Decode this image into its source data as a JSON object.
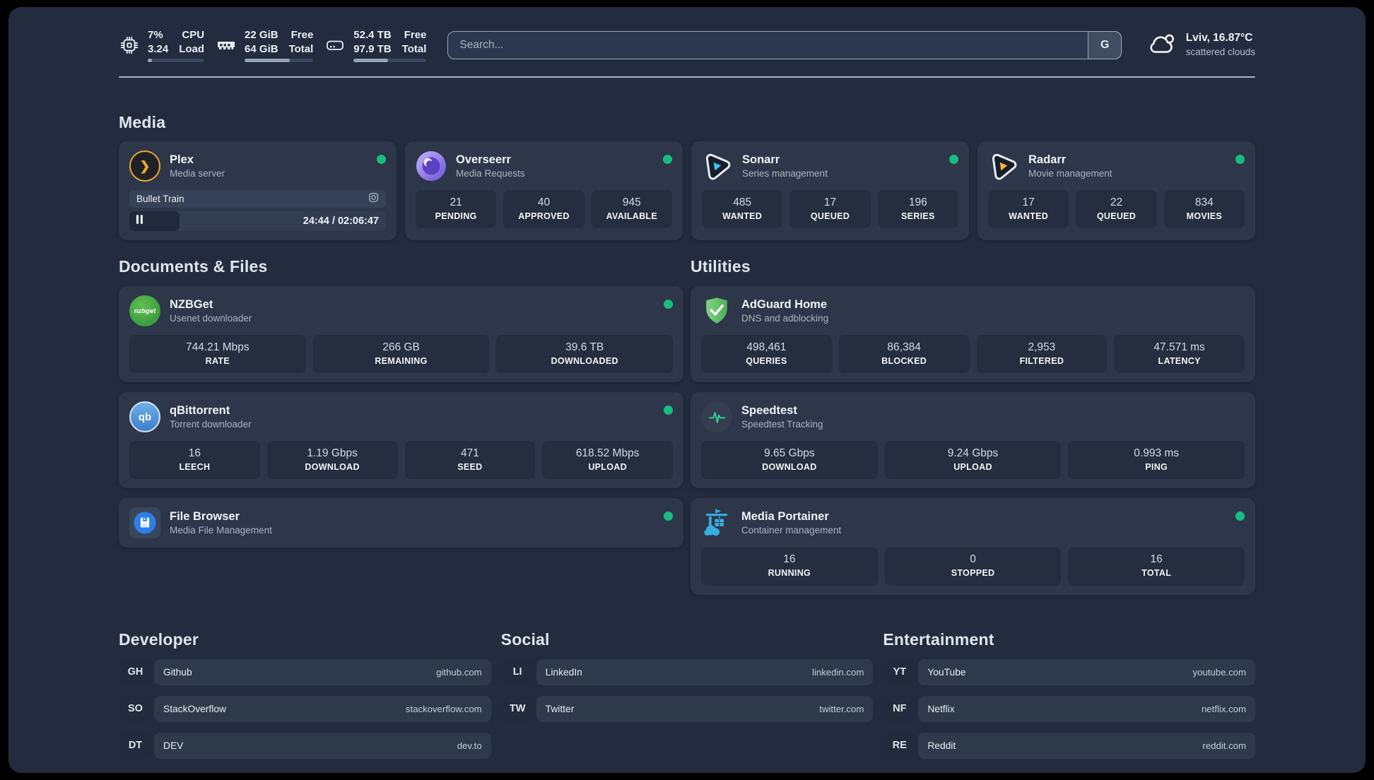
{
  "header": {
    "cpu": {
      "value_top": "7%",
      "value_bottom": "3.24",
      "label_top": "CPU",
      "label_bottom": "Load",
      "progress_pct": 7
    },
    "ram": {
      "value_top": "22 GiB",
      "value_bottom": "64 GiB",
      "label_top": "Free",
      "label_bottom": "Total",
      "progress_pct": 66
    },
    "disk": {
      "value_top": "52.4 TB",
      "value_bottom": "97.9 TB",
      "label_top": "Free",
      "label_bottom": "Total",
      "progress_pct": 47
    },
    "search": {
      "placeholder": "Search...",
      "provider_button": "G"
    },
    "weather": {
      "main": "Lviv, 16.87°C",
      "condition": "scattered clouds"
    }
  },
  "sections": {
    "media": "Media",
    "documents": "Documents & Files",
    "utilities": "Utilities",
    "developer": "Developer",
    "social": "Social",
    "entertainment": "Entertainment"
  },
  "apps": {
    "plex": {
      "name": "Plex",
      "desc": "Media server",
      "now_playing": {
        "title": "Bullet Train",
        "time": "24:44 / 02:06:47",
        "progress_pct": 19.5
      }
    },
    "overseerr": {
      "name": "Overseerr",
      "desc": "Media Requests",
      "stats": [
        {
          "value": "21",
          "label": "PENDING"
        },
        {
          "value": "40",
          "label": "APPROVED"
        },
        {
          "value": "945",
          "label": "AVAILABLE"
        }
      ]
    },
    "sonarr": {
      "name": "Sonarr",
      "desc": "Series management",
      "stats": [
        {
          "value": "485",
          "label": "WANTED"
        },
        {
          "value": "17",
          "label": "QUEUED"
        },
        {
          "value": "196",
          "label": "SERIES"
        }
      ]
    },
    "radarr": {
      "name": "Radarr",
      "desc": "Movie management",
      "stats": [
        {
          "value": "17",
          "label": "WANTED"
        },
        {
          "value": "22",
          "label": "QUEUED"
        },
        {
          "value": "834",
          "label": "MOVIES"
        }
      ]
    },
    "nzbget": {
      "name": "NZBGet",
      "desc": "Usenet downloader",
      "stats": [
        {
          "value": "744.21 Mbps",
          "label": "RATE"
        },
        {
          "value": "266 GB",
          "label": "REMAINING"
        },
        {
          "value": "39.6 TB",
          "label": "DOWNLOADED"
        }
      ]
    },
    "qbittorrent": {
      "name": "qBittorrent",
      "desc": "Torrent downloader",
      "stats": [
        {
          "value": "16",
          "label": "LEECH"
        },
        {
          "value": "1.19 Gbps",
          "label": "DOWNLOAD"
        },
        {
          "value": "471",
          "label": "SEED"
        },
        {
          "value": "618.52 Mbps",
          "label": "UPLOAD"
        }
      ]
    },
    "filebrowser": {
      "name": "File Browser",
      "desc": "Media File Management"
    },
    "adguard": {
      "name": "AdGuard Home",
      "desc": "DNS and adblocking",
      "stats": [
        {
          "value": "498,461",
          "label": "QUERIES"
        },
        {
          "value": "86,384",
          "label": "BLOCKED"
        },
        {
          "value": "2,953",
          "label": "FILTERED"
        },
        {
          "value": "47.571 ms",
          "label": "LATENCY"
        }
      ]
    },
    "speedtest": {
      "name": "Speedtest",
      "desc": "Speedtest Tracking",
      "stats": [
        {
          "value": "9.65 Gbps",
          "label": "DOWNLOAD"
        },
        {
          "value": "9.24 Gbps",
          "label": "UPLOAD"
        },
        {
          "value": "0.993 ms",
          "label": "PING"
        }
      ]
    },
    "portainer": {
      "name": "Media Portainer",
      "desc": "Container management",
      "stats": [
        {
          "value": "16",
          "label": "RUNNING"
        },
        {
          "value": "0",
          "label": "STOPPED"
        },
        {
          "value": "16",
          "label": "TOTAL"
        }
      ]
    }
  },
  "icon_text": {
    "plex_glyph": "❯",
    "qbittorrent_glyph": "qb",
    "nzbget_glyph": "nzbget"
  },
  "links": {
    "developer": [
      {
        "badge": "GH",
        "name": "Github",
        "url": "github.com"
      },
      {
        "badge": "SO",
        "name": "StackOverflow",
        "url": "stackoverflow.com"
      },
      {
        "badge": "DT",
        "name": "DEV",
        "url": "dev.to"
      }
    ],
    "social": [
      {
        "badge": "LI",
        "name": "LinkedIn",
        "url": "linkedin.com"
      },
      {
        "badge": "TW",
        "name": "Twitter",
        "url": "twitter.com"
      }
    ],
    "entertainment": [
      {
        "badge": "YT",
        "name": "YouTube",
        "url": "youtube.com"
      },
      {
        "badge": "NF",
        "name": "Netflix",
        "url": "netflix.com"
      },
      {
        "badge": "RE",
        "name": "Reddit",
        "url": "reddit.com"
      }
    ]
  },
  "colors": {
    "page_bg": "#232c3e",
    "card_bg": "#2d3749",
    "stat_bg": "#242e3e",
    "status_online": "#18bd80",
    "plex_orange": "#e8a82d",
    "sonarr_cyan": "#38c6f4",
    "radarr_yellow": "#ffb53d",
    "adguard_green": "#5cb564",
    "portainer_blue": "#37aee2",
    "speedtest_green": "#2fd49a",
    "qbittorrent_blue": "#3b7ecb",
    "nzbget_green": "#3ea544"
  }
}
